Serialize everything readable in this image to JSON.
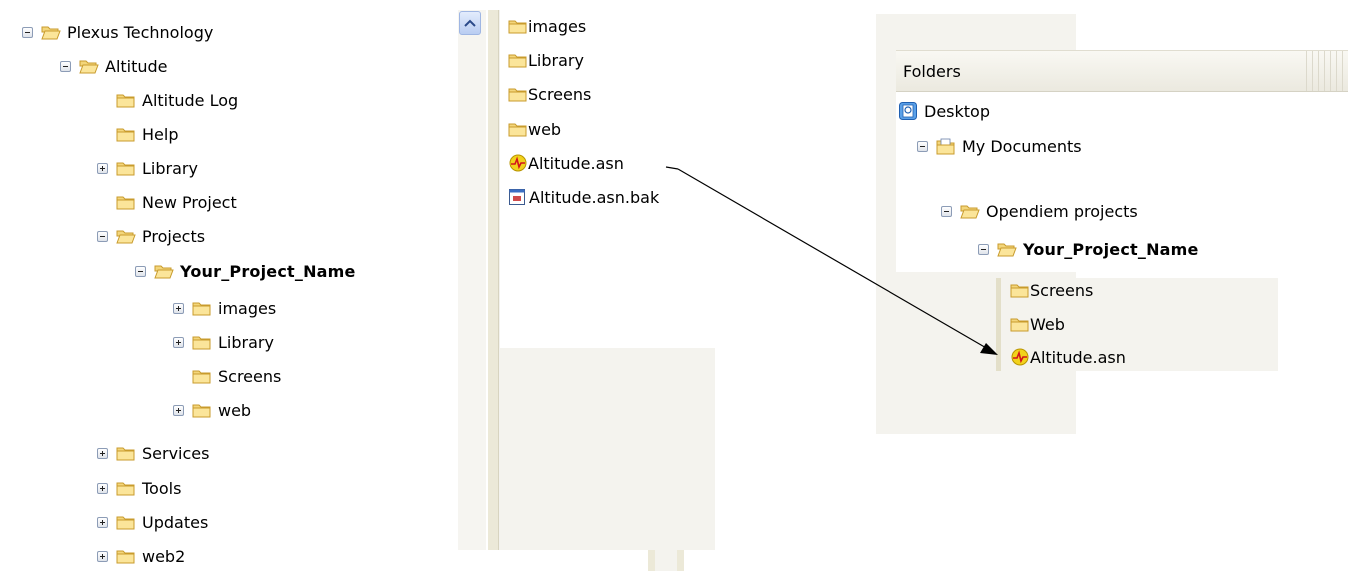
{
  "left_tree": [
    {
      "label": "Plexus Technology",
      "expander": "minus"
    },
    {
      "label": "Altitude",
      "expander": "minus"
    },
    {
      "label": "Altitude Log",
      "expander": "none"
    },
    {
      "label": "Help",
      "expander": "none"
    },
    {
      "label": "Library",
      "expander": "plus"
    },
    {
      "label": "New Project",
      "expander": "none"
    },
    {
      "label": "Projects",
      "expander": "minus"
    },
    {
      "label": "Your_Project_Name",
      "expander": "minus",
      "bold": true
    },
    {
      "label": "images",
      "expander": "plus"
    },
    {
      "label": "Library",
      "expander": "plus"
    },
    {
      "label": "Screens",
      "expander": "none"
    },
    {
      "label": "web",
      "expander": "plus"
    },
    {
      "label": "Services",
      "expander": "plus"
    },
    {
      "label": "Tools",
      "expander": "plus"
    },
    {
      "label": "Updates",
      "expander": "plus"
    },
    {
      "label": "web2",
      "expander": "plus"
    }
  ],
  "middle_list": [
    {
      "label": "images",
      "icon": "folder-icon"
    },
    {
      "label": "Library",
      "icon": "folder-icon"
    },
    {
      "label": "Screens",
      "icon": "folder-icon"
    },
    {
      "label": "web",
      "icon": "folder-icon"
    },
    {
      "label": "Altitude.asn",
      "icon": "altitude-file-icon"
    },
    {
      "label": "Altitude.asn.bak",
      "icon": "backup-file-icon"
    }
  ],
  "right_panel": {
    "header": "Folders",
    "tree": [
      {
        "label": "Desktop",
        "icon": "desktop-icon"
      },
      {
        "label": "My Documents",
        "icon": "documents-icon"
      },
      {
        "label": "Opendiem projects",
        "icon": "folder-icon"
      },
      {
        "label": "Your_Project_Name",
        "icon": "folder-icon"
      }
    ],
    "list": [
      {
        "label": "Screens",
        "icon": "folder-icon"
      },
      {
        "label": "Web",
        "icon": "folder-icon"
      },
      {
        "label": "Altitude.asn",
        "icon": "altitude-file-icon"
      }
    ]
  },
  "colors": {
    "folder_fill": "#f5d97a",
    "folder_edge": "#c9a032",
    "panel_gray": "#f4f3ee"
  }
}
